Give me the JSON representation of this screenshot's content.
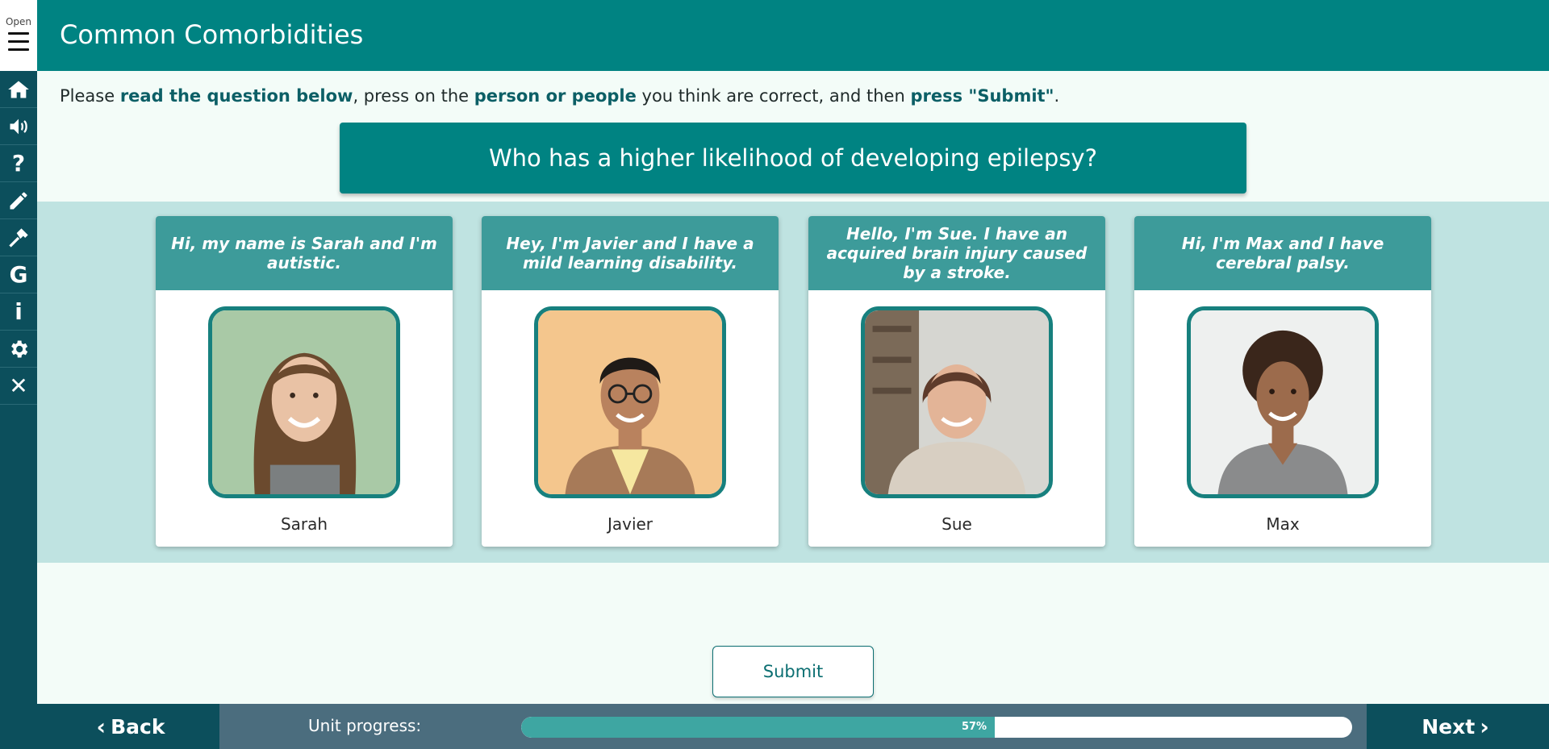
{
  "sidebar": {
    "open_label": "Open",
    "items": [
      {
        "icon": "home-icon"
      },
      {
        "icon": "speaker-icon"
      },
      {
        "icon": "help-icon",
        "glyph": "?"
      },
      {
        "icon": "pencil-icon"
      },
      {
        "icon": "hammer-icon"
      },
      {
        "icon": "glossary-icon",
        "glyph": "G"
      },
      {
        "icon": "info-icon",
        "glyph": "i"
      },
      {
        "icon": "gear-icon"
      },
      {
        "icon": "close-icon",
        "glyph": "✕"
      }
    ]
  },
  "header": {
    "title": "Common Comorbidities"
  },
  "instructions": {
    "part1": "Please ",
    "em1": "read the question below",
    "part2": ", press on the ",
    "em2": "person or people",
    "part3": " you think are correct, and then ",
    "em3": "press \"Submit\"",
    "part4": "."
  },
  "question": "Who has a higher likelihood of developing epilepsy?",
  "cards": [
    {
      "quote": "Hi, my name is Sarah and I'm autistic.",
      "name": "Sarah"
    },
    {
      "quote": "Hey, I'm Javier and I have a mild learning disability.",
      "name": "Javier"
    },
    {
      "quote": "Hello, I'm Sue. I have an acquired brain injury caused by a stroke.",
      "name": "Sue"
    },
    {
      "quote": "Hi, I'm Max and I have cerebral palsy.",
      "name": "Max"
    }
  ],
  "submit_label": "Submit",
  "footer": {
    "back_label": "Back",
    "next_label": "Next",
    "progress_label": "Unit progress:",
    "progress_text": "57%",
    "progress_value": 0.57
  },
  "colors": {
    "header": "#008382",
    "sidebar": "#0c4f5c",
    "card_head": "#3d9b9a",
    "band": "#bfe3e1",
    "progress_fill": "#3ea6a2"
  }
}
